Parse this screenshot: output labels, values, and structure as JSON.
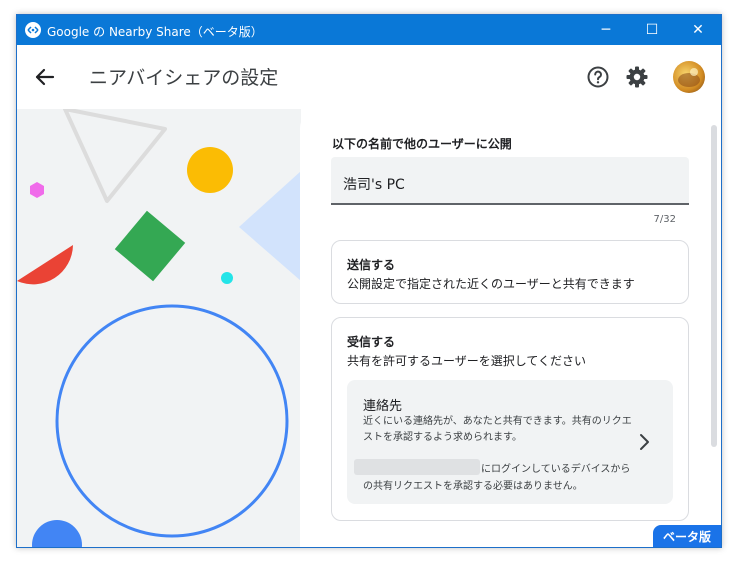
{
  "window": {
    "title": "Google の Nearby Share（ベータ版）",
    "controls": {
      "minimize": "─",
      "maximize": "☐",
      "close": "✕"
    },
    "accent": "#0a78d7"
  },
  "appbar": {
    "title": "ニアバイシェアの設定",
    "icons": [
      "back-arrow-icon",
      "help-icon",
      "gear-icon",
      "avatar"
    ]
  },
  "device_name": {
    "label": "以下の名前で他のユーザーに公開",
    "value": "浩司's PC",
    "char_count": "7/32"
  },
  "send": {
    "title": "送信する",
    "description": "公開設定で指定された近くのユーザーと共有できます"
  },
  "receive": {
    "title": "受信する",
    "description": "共有を許可するユーザーを選択してください",
    "contacts": {
      "title": "連絡先",
      "description": "近くにいる連絡先が、あなたと共有できます。共有のリクエストを承認するよう求められます。",
      "note_line1": "にログインしているデバイスから",
      "note_line2": "の共有リクエストを承認する必要はありません。"
    }
  },
  "badge": {
    "label": "ベータ版",
    "color": "#1a73e8"
  }
}
